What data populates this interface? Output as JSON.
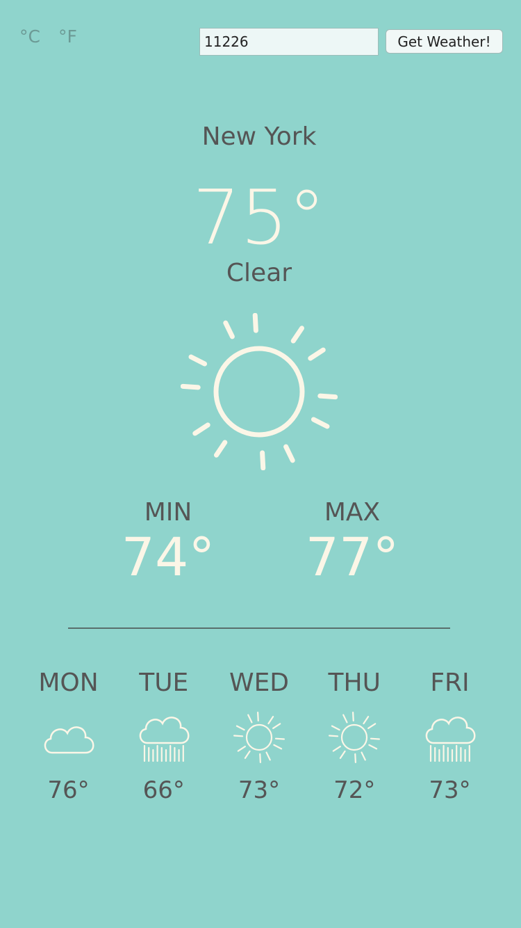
{
  "units": {
    "celsius": "°C",
    "fahrenheit": "°F"
  },
  "search": {
    "value": "11226",
    "button_label": "Get Weather!"
  },
  "current": {
    "city": "New York",
    "temperature": "75°",
    "condition": "Clear",
    "icon": "sun-icon",
    "min_label": "MIN",
    "min_value": "74°",
    "max_label": "MAX",
    "max_value": "77°"
  },
  "forecast": [
    {
      "day": "MON",
      "icon": "cloud-icon",
      "temp": "76°"
    },
    {
      "day": "TUE",
      "icon": "rain-cloud-icon",
      "temp": "66°"
    },
    {
      "day": "WED",
      "icon": "sun-icon",
      "temp": "73°"
    },
    {
      "day": "THU",
      "icon": "sun-icon",
      "temp": "72°"
    },
    {
      "day": "FRI",
      "icon": "rain-cloud-icon",
      "temp": "73°"
    }
  ],
  "colors": {
    "background": "#8fd4cc",
    "text": "#555555",
    "highlight": "#fbf6e7"
  }
}
